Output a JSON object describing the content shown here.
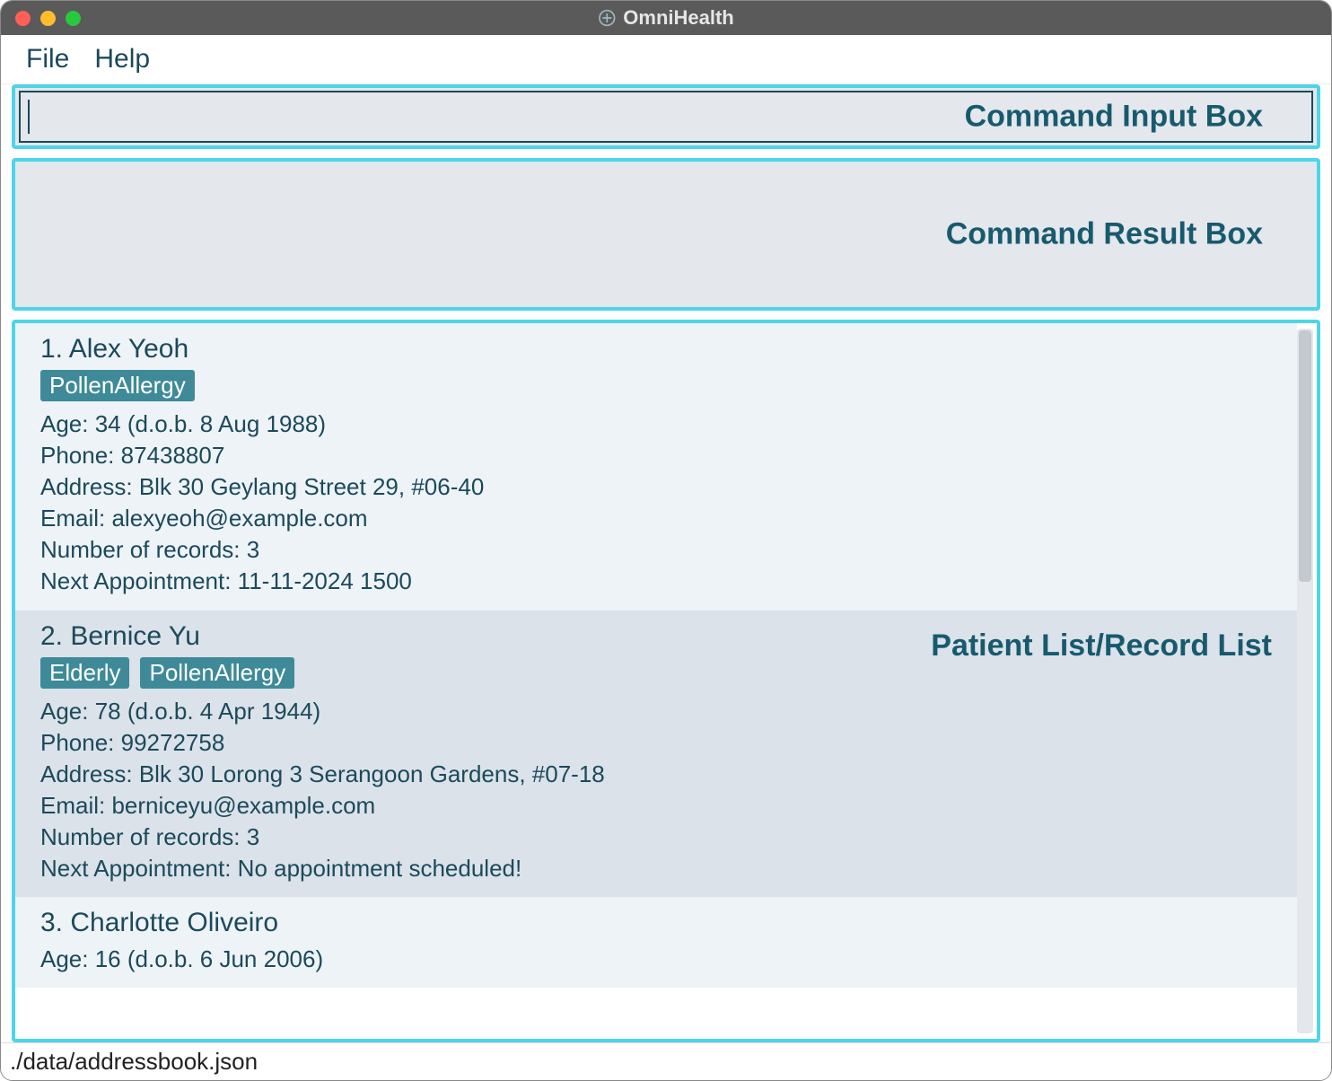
{
  "window": {
    "title": "OmniHealth"
  },
  "menubar": {
    "file": "File",
    "help": "Help"
  },
  "labels": {
    "commandInput": "Command Input Box",
    "commandResult": "Command Result Box",
    "patientList": "Patient List/Record List"
  },
  "commandInput": {
    "value": ""
  },
  "commandResult": {
    "text": ""
  },
  "fields": {
    "age": "Age:",
    "dobPrefix": "(d.o.b.",
    "dobSuffix": ")",
    "phone": "Phone:",
    "address": "Address:",
    "email": "Email:",
    "records": "Number of records:",
    "nextAppt": "Next Appointment:"
  },
  "patients": [
    {
      "index": "1.",
      "name": "Alex Yeoh",
      "tags": [
        "PollenAllergy"
      ],
      "age": "34",
      "dob": "8 Aug 1988",
      "phone": "87438807",
      "address": "Blk 30 Geylang Street 29, #06-40",
      "email": "alexyeoh@example.com",
      "records": "3",
      "nextAppt": "11-11-2024 1500"
    },
    {
      "index": "2.",
      "name": "Bernice Yu",
      "tags": [
        "Elderly",
        "PollenAllergy"
      ],
      "age": "78",
      "dob": "4 Apr 1944",
      "phone": "99272758",
      "address": "Blk 30 Lorong 3 Serangoon Gardens, #07-18",
      "email": "berniceyu@example.com",
      "records": "3",
      "nextAppt": "No appointment scheduled!"
    },
    {
      "index": "3.",
      "name": "Charlotte Oliveiro",
      "tags": [],
      "age": "16",
      "dob": "6 Jun 2006",
      "phone": "",
      "address": "",
      "email": "",
      "records": "",
      "nextAppt": ""
    }
  ],
  "statusbar": {
    "path": "./data/addressbook.json"
  }
}
